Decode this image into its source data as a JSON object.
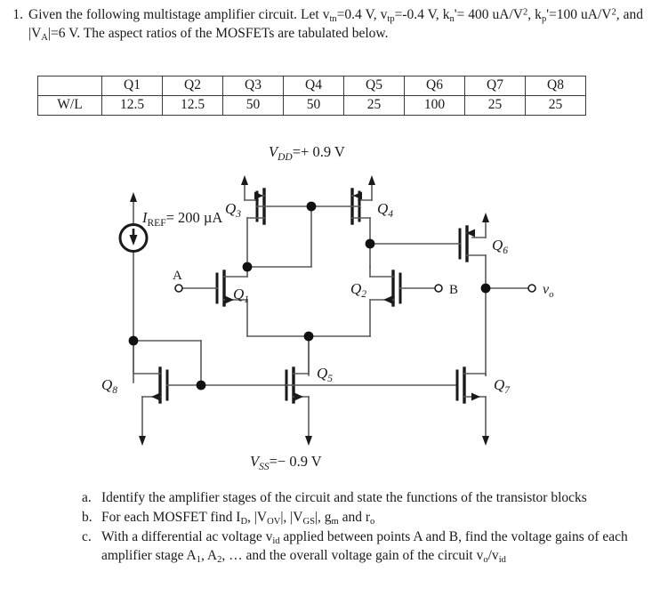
{
  "problem": {
    "number": "1.",
    "text_parts": {
      "p1": "Given the following multistage amplifier circuit.  Let v",
      "s1": "tn",
      "p2": "=0.4 V, v",
      "s2": "tp",
      "p3": "=-0.4 V, k",
      "s3": "n",
      "p4": "'= 400 uA/V",
      "sup1": "2",
      "p5": ", k",
      "s4": "p",
      "p6": "'=100 uA/V",
      "sup2": "2",
      "p7": ", and |V",
      "s5": "A",
      "p8": "|=6 V.  The aspect ratios of the MOSFETs are tabulated below."
    }
  },
  "table": {
    "row_header": "W/L",
    "columns": [
      "Q1",
      "Q2",
      "Q3",
      "Q4",
      "Q5",
      "Q6",
      "Q7",
      "Q8"
    ],
    "values": [
      "12.5",
      "12.5",
      "50",
      "50",
      "25",
      "100",
      "25",
      "25"
    ]
  },
  "circuit": {
    "supply_top": "V",
    "supply_top_sub": "DD",
    "supply_top_value": "=+ 0.9 V",
    "supply_bottom": "V",
    "supply_bottom_sub": "SS",
    "supply_bottom_value": "=− 0.9 V",
    "iref_label": "I",
    "iref_sub": "REF",
    "iref_value": "= 200 µA",
    "input_a": "A",
    "input_b": "B",
    "output": "v",
    "output_sub": "o",
    "output_color": "#3aa8d8",
    "transistors": [
      {
        "name": "Q",
        "sub": "1"
      },
      {
        "name": "Q",
        "sub": "2"
      },
      {
        "name": "Q",
        "sub": "3"
      },
      {
        "name": "Q",
        "sub": "4"
      },
      {
        "name": "Q",
        "sub": "5"
      },
      {
        "name": "Q",
        "sub": "6"
      },
      {
        "name": "Q",
        "sub": "7"
      },
      {
        "name": "Q",
        "sub": "8"
      }
    ]
  },
  "subquestions": [
    {
      "mark": "a.",
      "segments": [
        {
          "t": "Identify the amplifier stages of the circuit and state the functions of the transistor blocks",
          "k": "p"
        }
      ]
    },
    {
      "mark": "b.",
      "segments": [
        {
          "t": "For each MOSFET find I",
          "k": "p"
        },
        {
          "t": "D",
          "k": "sub"
        },
        {
          "t": ", |V",
          "k": "p"
        },
        {
          "t": "OV",
          "k": "sub"
        },
        {
          "t": "|, |V",
          "k": "p"
        },
        {
          "t": "GS",
          "k": "sub"
        },
        {
          "t": "|, g",
          "k": "p"
        },
        {
          "t": "m",
          "k": "sub"
        },
        {
          "t": " and r",
          "k": "p"
        },
        {
          "t": "o",
          "k": "sub"
        }
      ]
    },
    {
      "mark": "c.",
      "segments": [
        {
          "t": "With a differential ac voltage v",
          "k": "p"
        },
        {
          "t": "id",
          "k": "sub"
        },
        {
          "t": " applied between points A and B, find the voltage gains of each amplifier stage A",
          "k": "p"
        },
        {
          "t": "1",
          "k": "sub"
        },
        {
          "t": ", A",
          "k": "p"
        },
        {
          "t": "2",
          "k": "sub"
        },
        {
          "t": ", … and the overall voltage gain of the circuit v",
          "k": "p"
        },
        {
          "t": "o",
          "k": "sub"
        },
        {
          "t": "/v",
          "k": "p"
        },
        {
          "t": "id",
          "k": "sub"
        }
      ]
    }
  ]
}
